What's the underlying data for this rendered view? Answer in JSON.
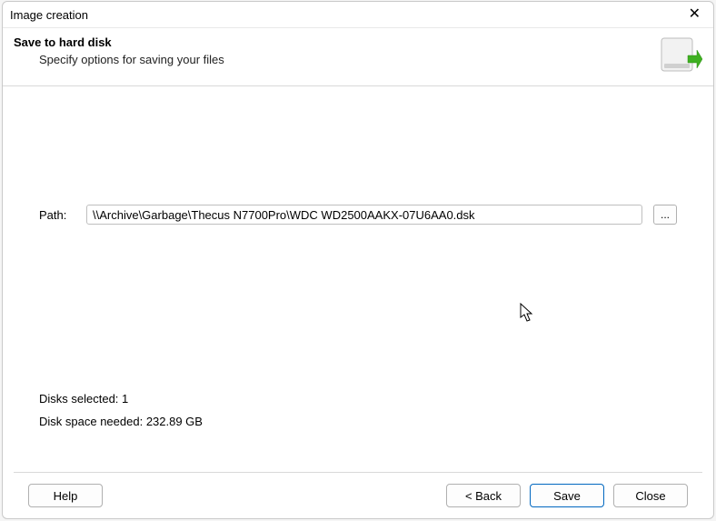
{
  "titlebar": {
    "title": "Image creation"
  },
  "header": {
    "heading": "Save to hard disk",
    "subheading": "Specify options for saving your files"
  },
  "form": {
    "path_label": "Path:",
    "path_value": "\\\\Archive\\Garbage\\Thecus N7700Pro\\WDC WD2500AAKX-07U6AA0.dsk",
    "browse_label": "..."
  },
  "status": {
    "disks_selected_label": "Disks selected:",
    "disks_selected_value": "1",
    "space_needed_label": "Disk space needed:",
    "space_needed_value": "232.89 GB"
  },
  "footer": {
    "help": "Help",
    "back": "< Back",
    "save": "Save",
    "close": "Close"
  }
}
